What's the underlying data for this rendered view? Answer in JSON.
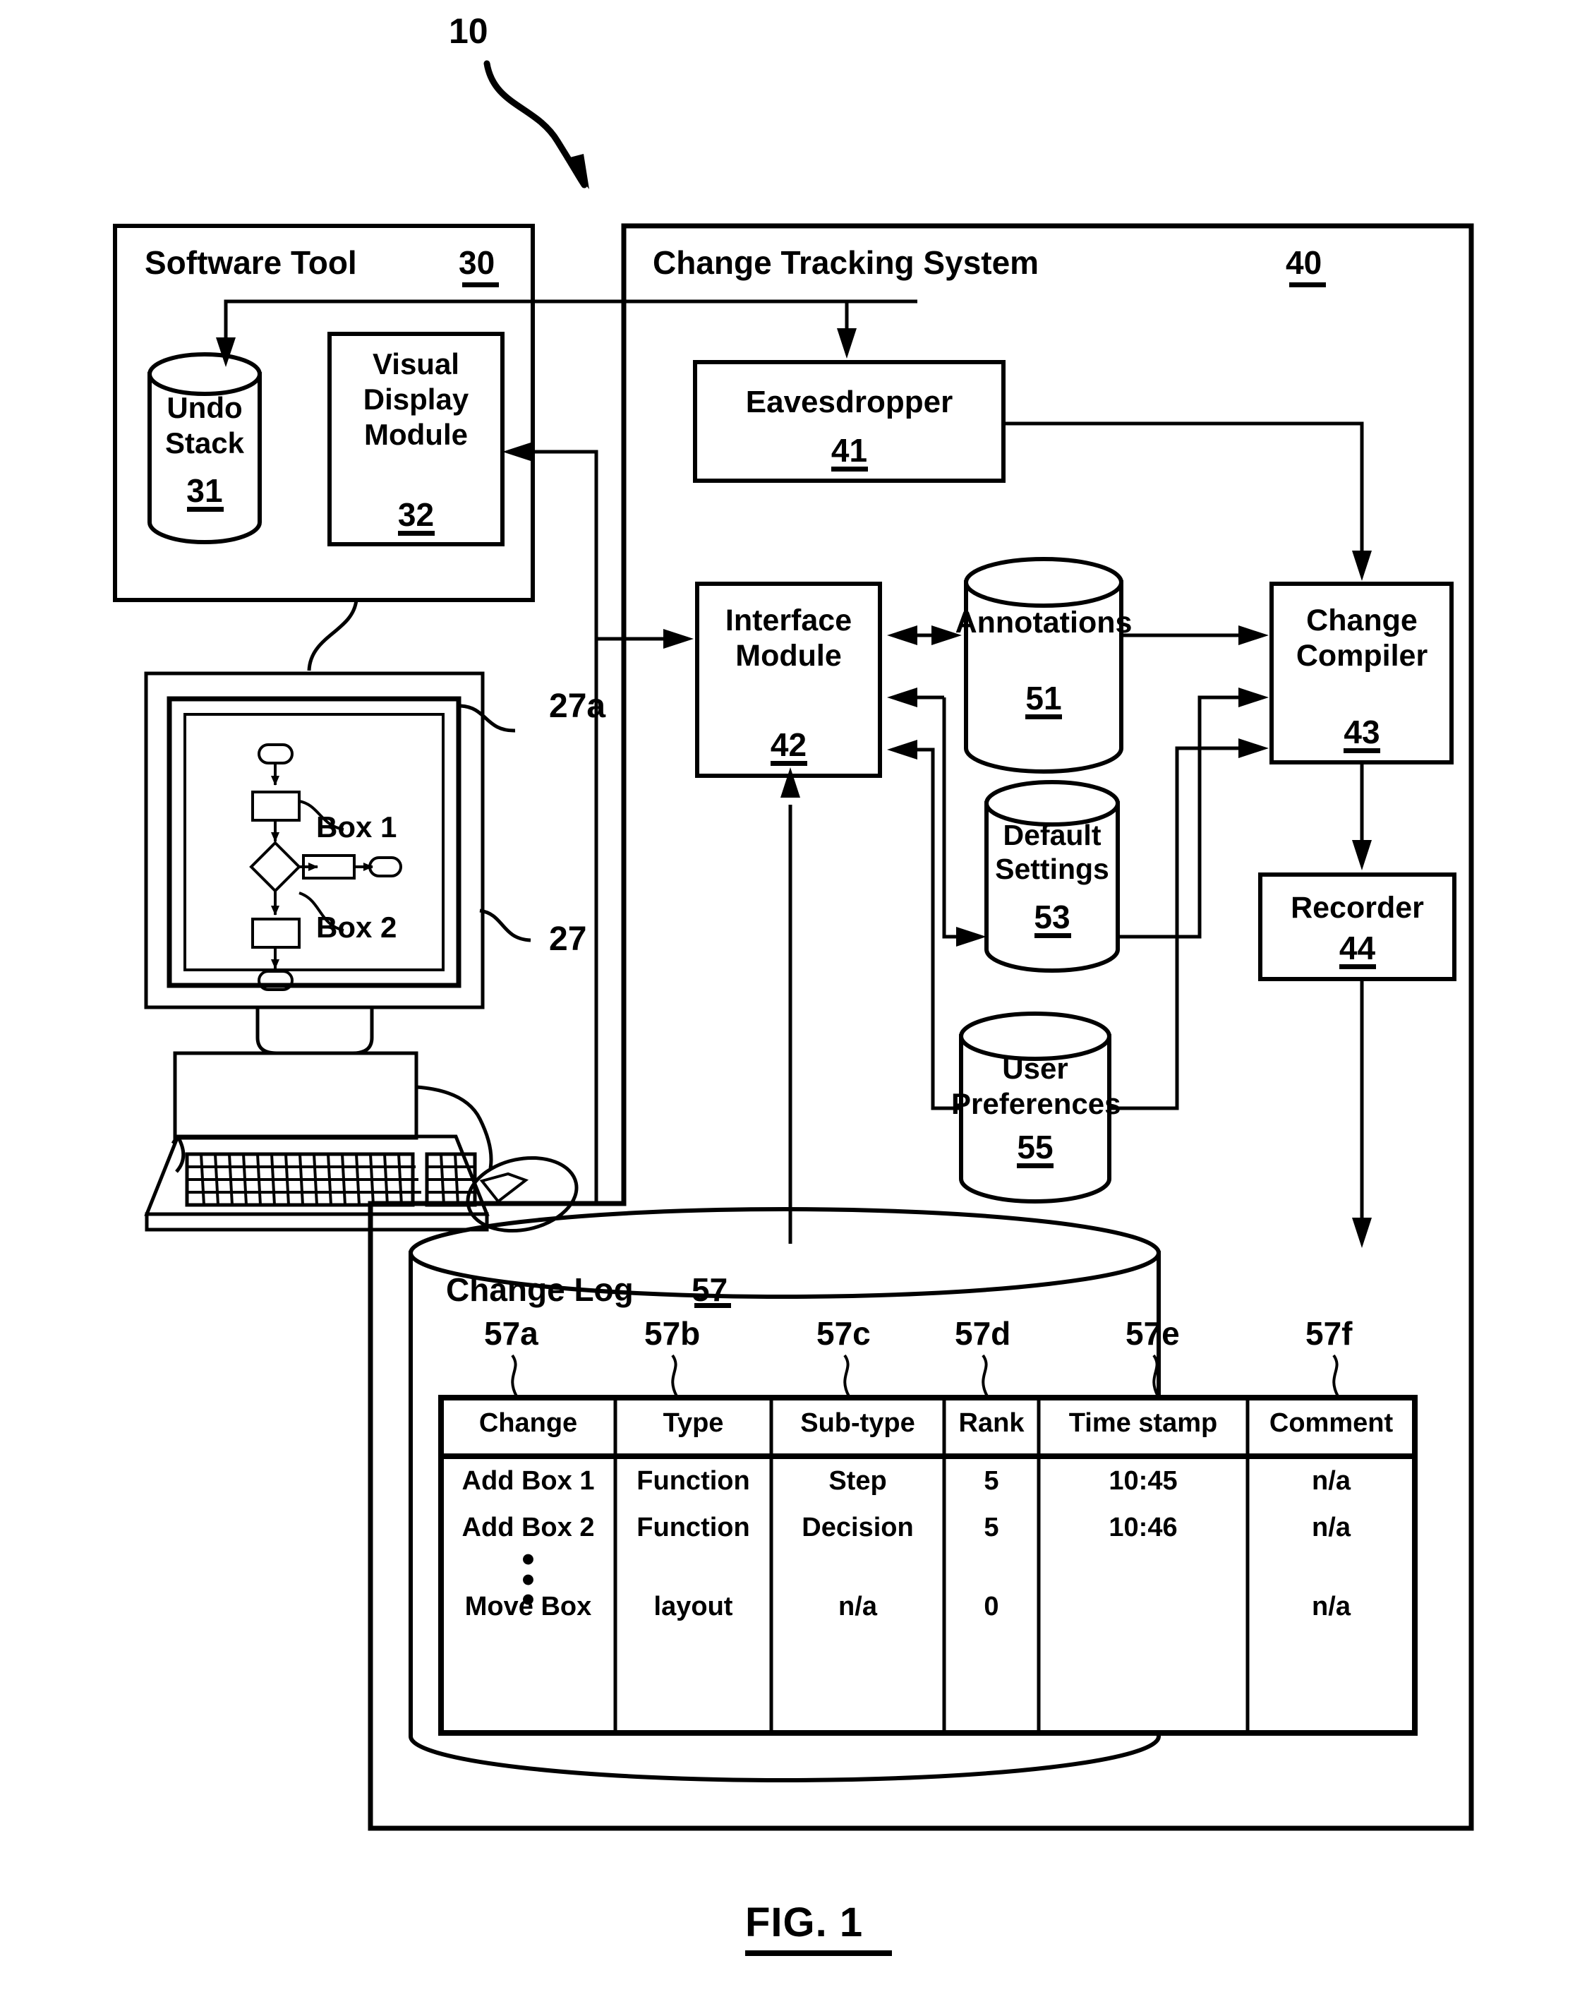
{
  "figure": {
    "caption": "FIG. 1",
    "system_ref": "10"
  },
  "software_tool": {
    "title": "Software Tool",
    "ref": "30",
    "undo_stack": {
      "label_line1": "Undo",
      "label_line2": "Stack",
      "ref": "31"
    },
    "visual_display_module": {
      "label_line1": "Visual",
      "label_line2": "Display",
      "label_line3": "Module",
      "ref": "32"
    }
  },
  "change_tracking_system": {
    "title": "Change Tracking System",
    "ref": "40",
    "eavesdropper": {
      "label": "Eavesdropper",
      "ref": "41"
    },
    "interface_module": {
      "label_line1": "Interface",
      "label_line2": "Module",
      "ref": "42"
    },
    "change_compiler": {
      "label_line1": "Change",
      "label_line2": "Compiler",
      "ref": "43"
    },
    "recorder": {
      "label": "Recorder",
      "ref": "44"
    },
    "annotations": {
      "label": "Annotations",
      "ref": "51"
    },
    "default_settings": {
      "label_line1": "Default",
      "label_line2": "Settings",
      "ref": "53"
    },
    "user_preferences": {
      "label_line1": "User",
      "label_line2": "Preferences",
      "ref": "55"
    }
  },
  "workstation": {
    "monitor_ref": "27",
    "screen_ref": "27a",
    "flowchart": {
      "box1_label": "Box 1",
      "box2_label": "Box 2"
    }
  },
  "change_log": {
    "title": "Change Log",
    "ref": "57",
    "column_refs": [
      "57a",
      "57b",
      "57c",
      "57d",
      "57e",
      "57f"
    ],
    "columns": [
      "Change",
      "Type",
      "Sub-type",
      "Rank",
      "Time stamp",
      "Comment"
    ],
    "rows": [
      [
        "Add Box 1",
        "Function",
        "Step",
        "5",
        "10:45",
        "n/a"
      ],
      [
        "Add Box 2",
        "Function",
        "Decision",
        "5",
        "10:46",
        "n/a"
      ],
      [
        "Move Box",
        "layout",
        "n/a",
        "0",
        "",
        "n/a"
      ]
    ],
    "ellipsis": "⋮"
  },
  "colors": {
    "line": "#000000",
    "background": "#ffffff"
  }
}
